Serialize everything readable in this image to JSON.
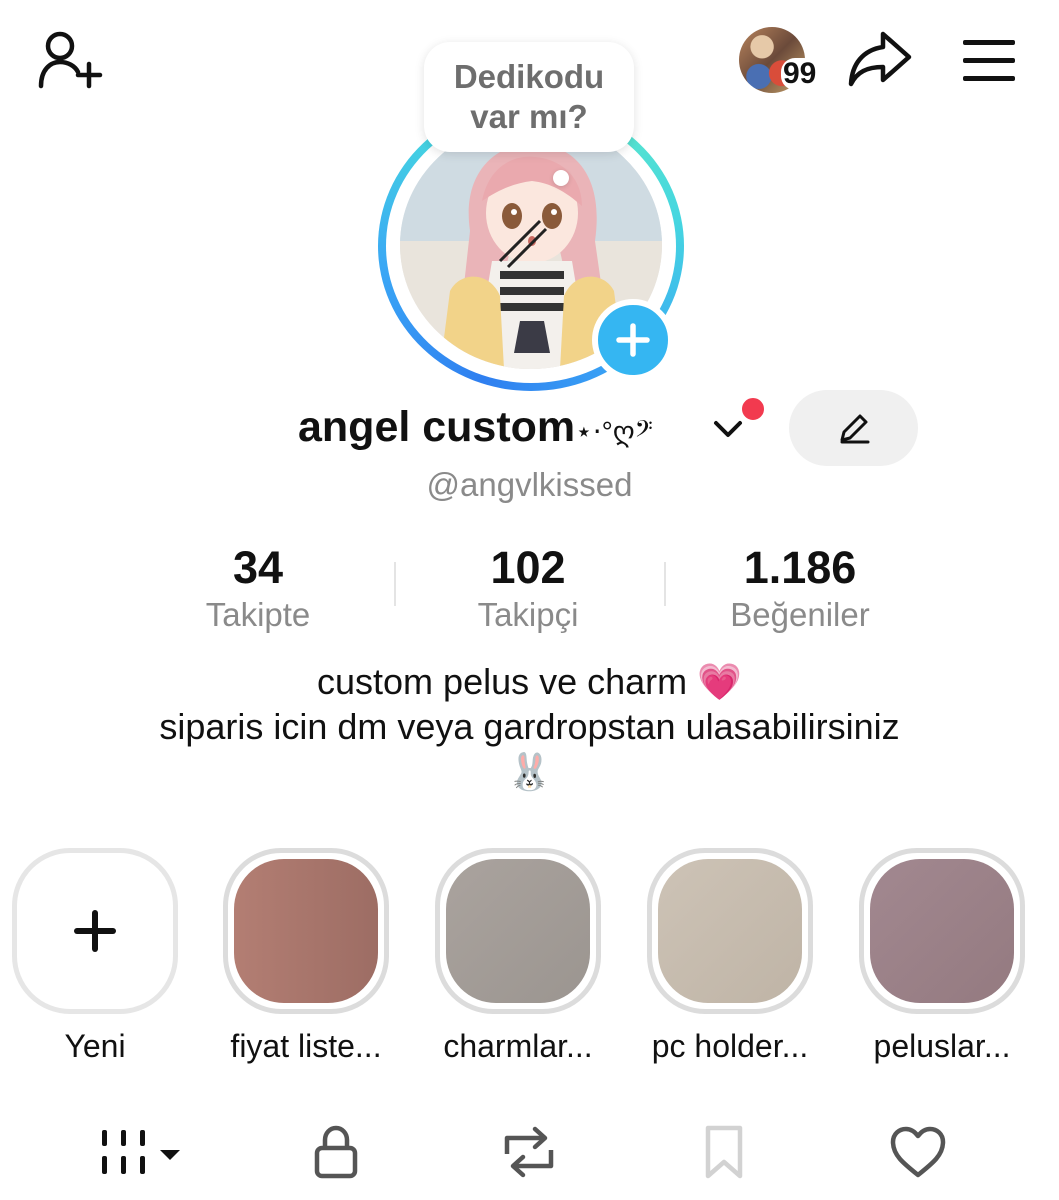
{
  "avatar_bubble": {
    "text_line1": "Dedikodu",
    "text_line2": "var mı?"
  },
  "notifications": {
    "count": "99"
  },
  "profile": {
    "name": "angel custom",
    "name_decoration": "⋆⋅°ღ𝄢",
    "handle": "@angvlkissed"
  },
  "stats": [
    {
      "value": "34",
      "label": "Takipte"
    },
    {
      "value": "102",
      "label": "Takipçi"
    },
    {
      "value": "1.186",
      "label": "Beğeniler"
    }
  ],
  "bio": {
    "line1": "custom pelus ve charm 💗",
    "line2": "siparis icin dm veya gardropstan ulasabilirsiniz",
    "line3": "🐰"
  },
  "highlights": [
    {
      "label": "Yeni",
      "icon": "plus-icon"
    },
    {
      "label": "fiyat liste...",
      "color": "#a7766c"
    },
    {
      "label": "charmlar...",
      "color": "#a39d98"
    },
    {
      "label": "pc holder...",
      "color": "#c7bcae"
    },
    {
      "label": "peluslar...",
      "color": "#9c8287"
    }
  ],
  "tabs": [
    "grid-icon",
    "lock-icon",
    "repost-icon",
    "bookmark-icon",
    "heart-icon"
  ],
  "colors": {
    "accent_blue": "#35b6f2",
    "red_dot": "#f23a4f",
    "ring_start": "#2f7ff0",
    "ring_end": "#5ee9c8"
  }
}
